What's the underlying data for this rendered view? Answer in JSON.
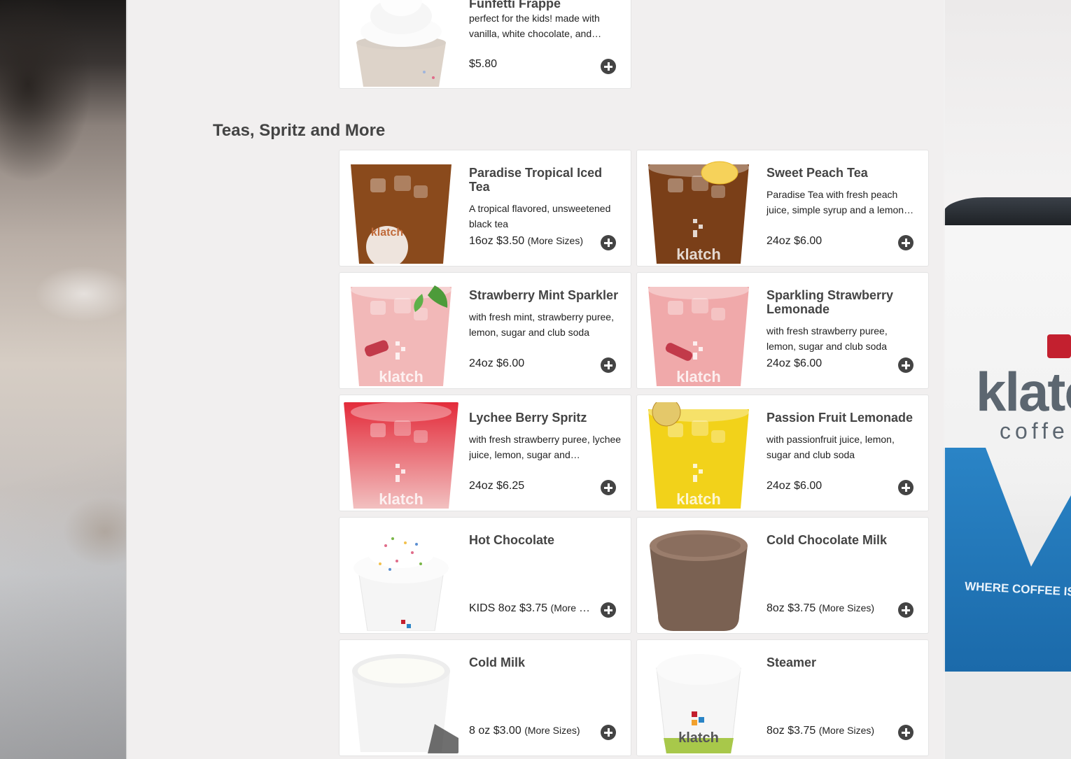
{
  "background": {
    "cup_brand": "klatc",
    "cup_coffee": "coffe",
    "cup_slogan": "WHERE COFFEE IS THE C"
  },
  "top_item": {
    "name": "Funfetti Frappe",
    "description": "perfect for the kids! made with vanilla, white chocolate, and…",
    "price": "$5.80",
    "add_icon": "plus-circle-icon"
  },
  "section": {
    "title": "Teas, Spritz and More",
    "items": [
      {
        "name": "Paradise Tropical Iced Tea",
        "description": "A tropical flavored, unsweetened black tea",
        "price": "16oz $3.50",
        "more": "(More Sizes)",
        "color": "#8a4a1c"
      },
      {
        "name": "Sweet Peach Tea",
        "description": "Paradise Tea with fresh peach juice, simple syrup and a lemon…",
        "price": "24oz $6.00",
        "more": "",
        "color": "#7a3f18"
      },
      {
        "name": "Strawberry Mint Sparkler",
        "description": "with fresh mint, strawberry puree, lemon, sugar and club soda",
        "price": "24oz $6.00",
        "more": "",
        "color": "#f2b8b8"
      },
      {
        "name": "Sparkling Strawberry Lemonade",
        "description": "with fresh strawberry puree, lemon, sugar and club soda",
        "price": "24oz $6.00",
        "more": "",
        "color": "#f0a9aa"
      },
      {
        "name": "Lychee Berry Spritz",
        "description": "with fresh strawberry puree, lychee juice, lemon, sugar and…",
        "price": "24oz $6.25",
        "more": "",
        "color": "#e23a4a"
      },
      {
        "name": "Passion Fruit Lemonade",
        "description": "with passionfruit juice, lemon, sugar and club soda",
        "price": "24oz $6.00",
        "more": "",
        "color": "#f2d21a"
      },
      {
        "name": "Hot Chocolate",
        "description": "",
        "price": "KIDS 8oz $3.75",
        "more": "(More Si…",
        "color": "#ffffff"
      },
      {
        "name": "Cold Chocolate Milk",
        "description": "",
        "price": "8oz $3.75",
        "more": "(More Sizes)",
        "color": "#7a5e4e"
      },
      {
        "name": "Cold Milk",
        "description": "",
        "price": "8 oz $3.00",
        "more": "(More Sizes)",
        "color": "#ffffff"
      },
      {
        "name": "Steamer",
        "description": "",
        "price": "8oz $3.75",
        "more": "(More Sizes)",
        "color": "#ffffff"
      }
    ]
  }
}
